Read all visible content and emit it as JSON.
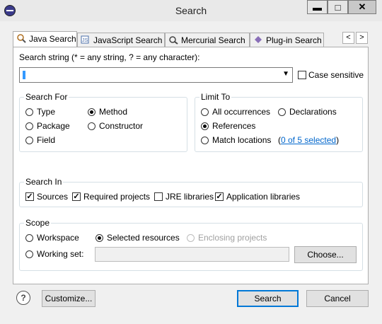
{
  "window": {
    "title": "Search",
    "controls": {
      "minimize": "▬",
      "maximize": "□",
      "close": "✕"
    }
  },
  "tabs": [
    {
      "label": "Java Search",
      "icon": "java-search-icon",
      "active": true
    },
    {
      "label": "JavaScript Search",
      "icon": "javascript-search-icon"
    },
    {
      "label": "Mercurial Search",
      "icon": "mercurial-search-icon"
    },
    {
      "label": "Plug-in Search",
      "icon": "plugin-search-icon"
    }
  ],
  "tab_scroll": {
    "left": "<",
    "right": ">"
  },
  "search_string": {
    "label": "Search string (* = any string, ? = any character):",
    "value": "",
    "case_sensitive_label": "Case sensitive",
    "case_sensitive_checked": false
  },
  "search_for": {
    "title": "Search For",
    "options": {
      "type": "Type",
      "package": "Package",
      "field": "Field",
      "method": "Method",
      "constructor": "Constructor"
    },
    "selected": "Method"
  },
  "limit_to": {
    "title": "Limit To",
    "options": {
      "all": "All occurrences",
      "declarations": "Declarations",
      "references": "References",
      "match": "Match locations"
    },
    "selected": "References",
    "match_link": "0 of 5 selected",
    "paren_open": "(",
    "paren_close": ")"
  },
  "search_in": {
    "title": "Search In",
    "sources": "Sources",
    "required": "Required projects",
    "jre": "JRE libraries",
    "application": "Application libraries",
    "checked": [
      "Sources",
      "Required projects",
      "Application libraries"
    ]
  },
  "scope": {
    "title": "Scope",
    "workspace": "Workspace",
    "selected_resources": "Selected resources",
    "enclosing": "Enclosing projects",
    "working_set": "Working set:",
    "working_set_value": "",
    "choose": "Choose...",
    "selected": "Selected resources"
  },
  "footer": {
    "help": "?",
    "customize": "Customize...",
    "search": "Search",
    "cancel": "Cancel"
  }
}
